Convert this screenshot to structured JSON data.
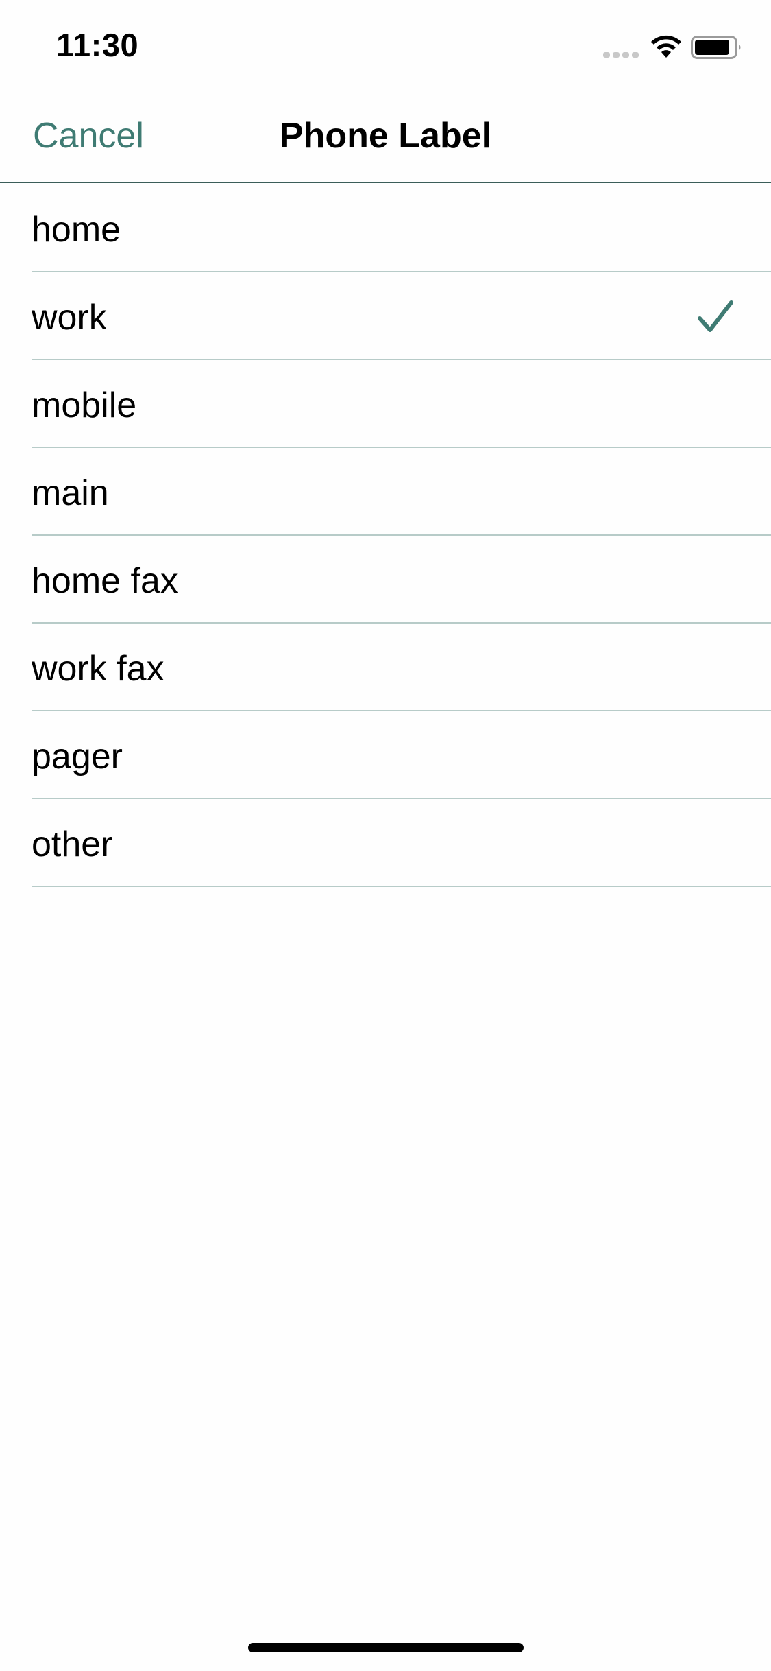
{
  "status_bar": {
    "time": "11:30",
    "icons": [
      "signal-icon",
      "wifi-icon",
      "battery-icon"
    ]
  },
  "nav": {
    "cancel_label": "Cancel",
    "title": "Phone Label"
  },
  "labels": [
    {
      "label": "home",
      "selected": false
    },
    {
      "label": "work",
      "selected": true
    },
    {
      "label": "mobile",
      "selected": false
    },
    {
      "label": "main",
      "selected": false
    },
    {
      "label": "home fax",
      "selected": false
    },
    {
      "label": "work fax",
      "selected": false
    },
    {
      "label": "pager",
      "selected": false
    },
    {
      "label": "other",
      "selected": false
    }
  ],
  "colors": {
    "accent": "#3f7b73",
    "separator": "#b7cbc8",
    "nav_border": "#3b5e59",
    "background": "#fefefe"
  },
  "selected_icon": "checkmark-icon"
}
